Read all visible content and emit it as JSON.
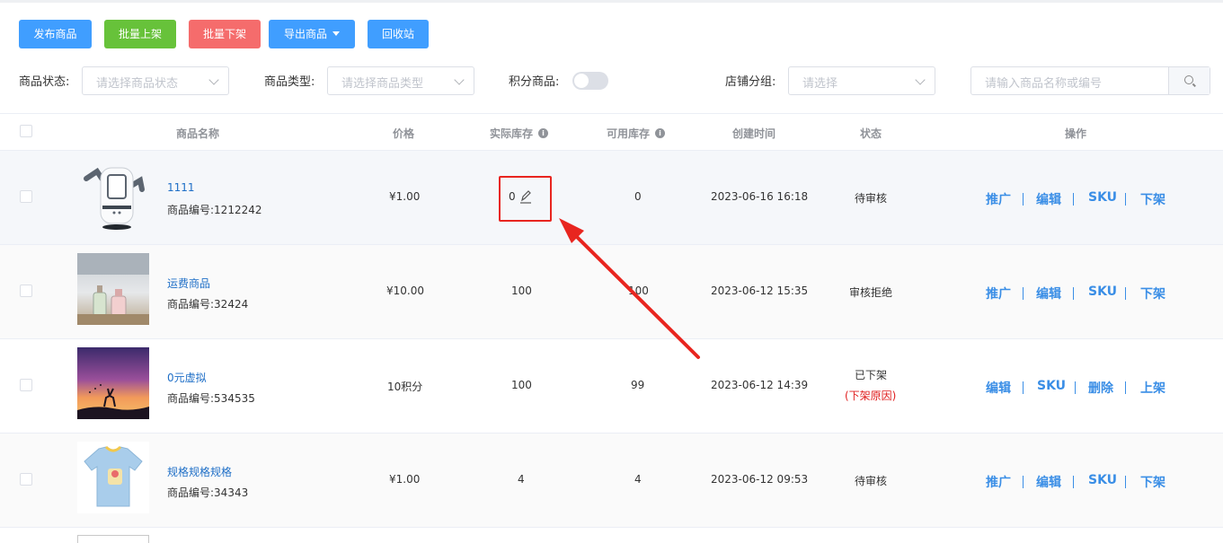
{
  "toolbar": {
    "publish": "发布商品",
    "batch_on": "批量上架",
    "batch_off": "批量下架",
    "export": "导出商品",
    "recycle": "回收站"
  },
  "filters": {
    "status_label": "商品状态:",
    "status_placeholder": "请选择商品状态",
    "type_label": "商品类型:",
    "type_placeholder": "请选择商品类型",
    "points_label": "积分商品:",
    "points_enabled": false,
    "group_label": "店铺分组:",
    "group_placeholder": "请选择",
    "search_placeholder": "请输入商品名称或编号"
  },
  "table": {
    "headers": {
      "name": "商品名称",
      "price": "价格",
      "actual_stock": "实际库存",
      "available_stock": "可用库存",
      "created": "创建时间",
      "status": "状态",
      "ops": "操作"
    },
    "rows": [
      {
        "name": "1111",
        "code": "商品编号:1212242",
        "price": "¥1.00",
        "actual_stock": "0",
        "available_stock": "0",
        "created": "2023-06-16 16:18",
        "status": "待审核",
        "reason": "",
        "image": "robot-speaker",
        "ops": [
          "推广",
          "编辑",
          "SKU",
          "下架"
        ]
      },
      {
        "name": "运费商品",
        "code": "商品编号:32424",
        "price": "¥10.00",
        "actual_stock": "100",
        "available_stock": "100",
        "created": "2023-06-12 15:35",
        "status": "审核拒绝",
        "reason": "",
        "image": "perfume-bottles",
        "ops": [
          "推广",
          "编辑",
          "SKU",
          "下架"
        ]
      },
      {
        "name": "0元虚拟",
        "code": "商品编号:534535",
        "price": "10积分",
        "actual_stock": "100",
        "available_stock": "99",
        "created": "2023-06-12 14:39",
        "status": "已下架",
        "reason": "(下架原因)",
        "image": "sunset-deer",
        "ops": [
          "编辑",
          "SKU",
          "删除",
          "上架"
        ]
      },
      {
        "name": "规格规格规格",
        "code": "商品编号:34343",
        "price": "¥1.00",
        "actual_stock": "4",
        "available_stock": "4",
        "created": "2023-06-12 09:53",
        "status": "待审核",
        "reason": "",
        "image": "kids-tshirt",
        "ops": [
          "推广",
          "编辑",
          "SKU",
          "下架"
        ]
      }
    ]
  },
  "annotation": {
    "color": "#e8251f",
    "icon": "edit-pencil-icon"
  }
}
